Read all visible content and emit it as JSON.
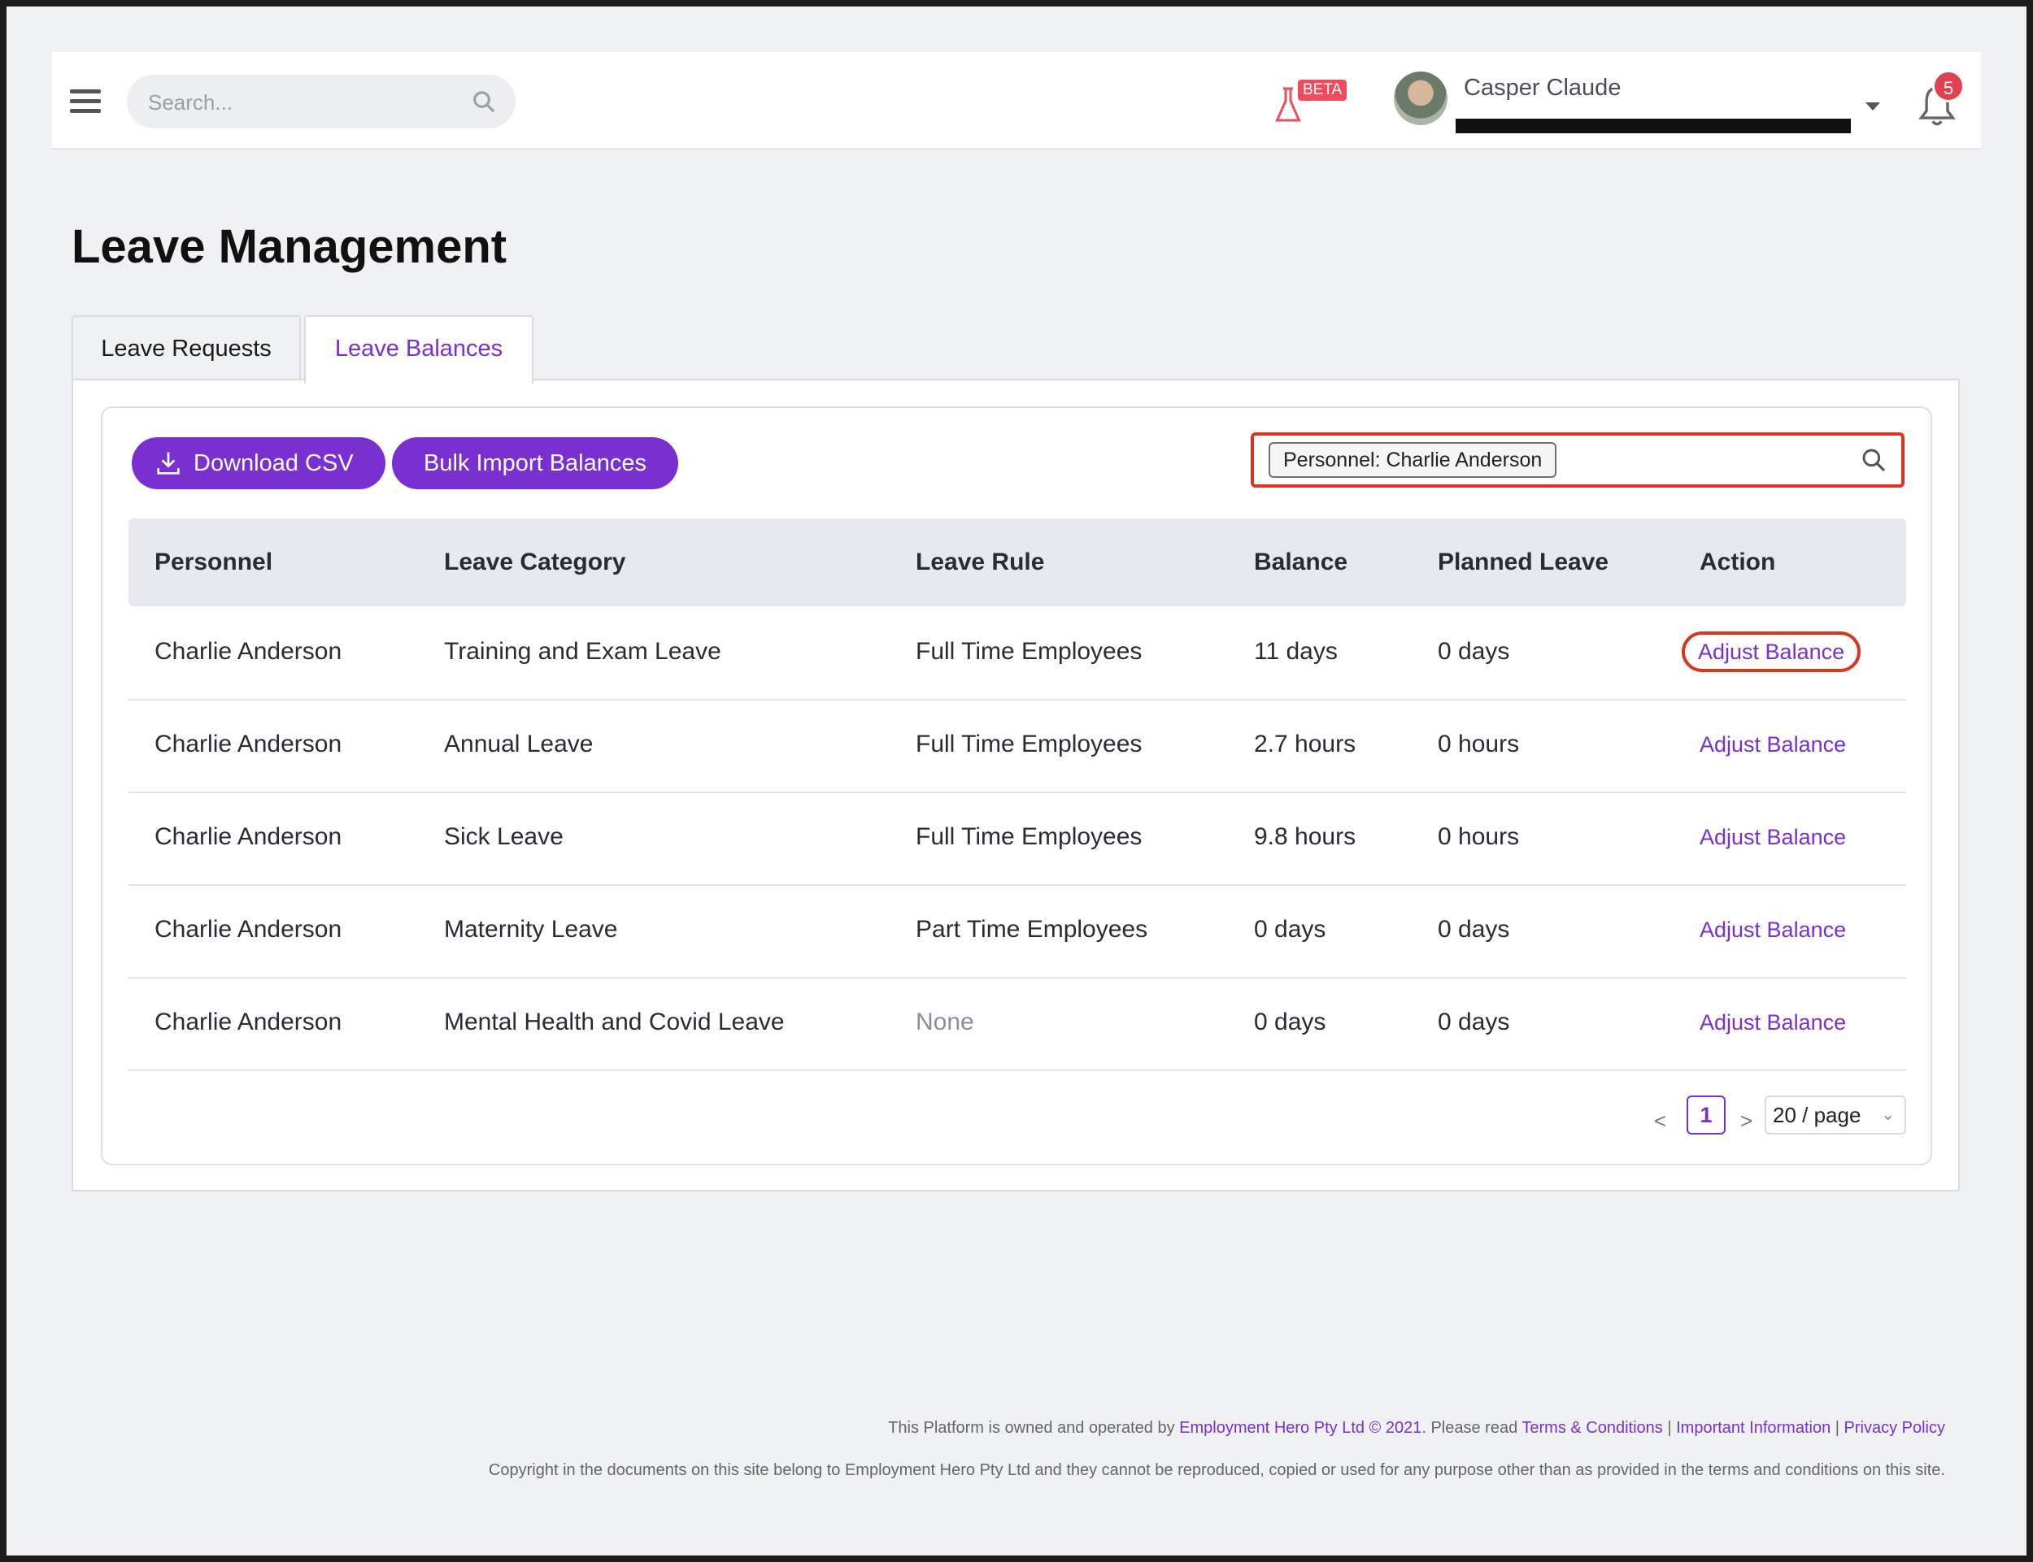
{
  "header": {
    "search_placeholder": "Search...",
    "beta_label": "BETA",
    "user_name": "Casper Claude",
    "notification_count": "5"
  },
  "page": {
    "title": "Leave Management",
    "tabs": [
      {
        "label": "Leave Requests",
        "active": false
      },
      {
        "label": "Leave Balances",
        "active": true
      }
    ]
  },
  "toolbar": {
    "download_csv_label": "Download CSV",
    "bulk_import_label": "Bulk Import Balances",
    "filter_tag": "Personnel: Charlie Anderson"
  },
  "table": {
    "columns": [
      "Personnel",
      "Leave Category",
      "Leave Rule",
      "Balance",
      "Planned Leave",
      "Action"
    ],
    "rows": [
      {
        "personnel": "Charlie Anderson",
        "category": "Training and Exam Leave",
        "rule": "Full Time Employees",
        "balance": "11 days",
        "planned": "0 days",
        "action": "Adjust Balance"
      },
      {
        "personnel": "Charlie Anderson",
        "category": "Annual Leave",
        "rule": "Full Time Employees",
        "balance": "2.7 hours",
        "planned": "0 hours",
        "action": "Adjust Balance"
      },
      {
        "personnel": "Charlie Anderson",
        "category": "Sick Leave",
        "rule": "Full Time Employees",
        "balance": "9.8 hours",
        "planned": "0 hours",
        "action": "Adjust Balance"
      },
      {
        "personnel": "Charlie Anderson",
        "category": "Maternity Leave",
        "rule": "Part Time Employees",
        "balance": "0 days",
        "planned": "0 days",
        "action": "Adjust Balance"
      },
      {
        "personnel": "Charlie Anderson",
        "category": "Mental Health and Covid Leave",
        "rule": "None",
        "balance": "0 days",
        "planned": "0 days",
        "action": "Adjust Balance"
      }
    ]
  },
  "pagination": {
    "prev": "<",
    "current_page": "1",
    "next": ">",
    "page_size": "20 / page"
  },
  "footer": {
    "line1_prefix": "This Platform is owned and operated by ",
    "company_link": "Employment Hero Pty Ltd © 2021",
    "line1_mid": ". Please read ",
    "terms_link": "Terms & Conditions",
    "sep": " | ",
    "info_link": "Important Information",
    "privacy_link": "Privacy Policy",
    "line2": "Copyright in the documents on this site belong to Employment Hero Pty Ltd and they cannot be reproduced, copied or used for any purpose other than as provided in the terms and conditions on this site."
  },
  "colors": {
    "accent": "#7a2fd0",
    "highlight": "#d9351f",
    "badge": "#e0424f"
  }
}
